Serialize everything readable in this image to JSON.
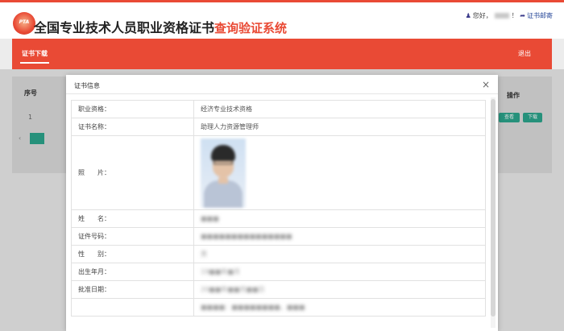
{
  "header": {
    "logo_text": "PTA",
    "title_main": "全国专业技术人员职业资格证书",
    "title_accent": "查询验证系统",
    "greeting": "您好，",
    "user_name": "",
    "user_suffix": "！",
    "link_cert": "证书邮寄"
  },
  "nav": {
    "tab_active": "证书下载",
    "exit": "退出"
  },
  "background_table": {
    "col_index": "序号",
    "col_operation": "操作",
    "row_index": "1",
    "btn_view": "查看",
    "btn_download": "下载"
  },
  "modal": {
    "title": "证书信息",
    "close": "×",
    "rows": [
      {
        "label": "职业资格：",
        "value": "经济专业技术资格"
      },
      {
        "label": "证书名称：",
        "value": "助理人力资源管理师"
      },
      {
        "label": "照　　片：",
        "value": ""
      },
      {
        "label": "姓　　名：",
        "value": "■■■"
      },
      {
        "label": "证件号码：",
        "value": "■■■■■■■■■■■■■■■"
      },
      {
        "label": "性　　别：",
        "value": "男"
      },
      {
        "label": "出生年月：",
        "value": "19■■年■月"
      },
      {
        "label": "批准日期：",
        "value": "20■■年■■月■■日"
      },
      {
        "label": "",
        "value": "■■■■：■■■■■■■■，■■■"
      }
    ]
  }
}
